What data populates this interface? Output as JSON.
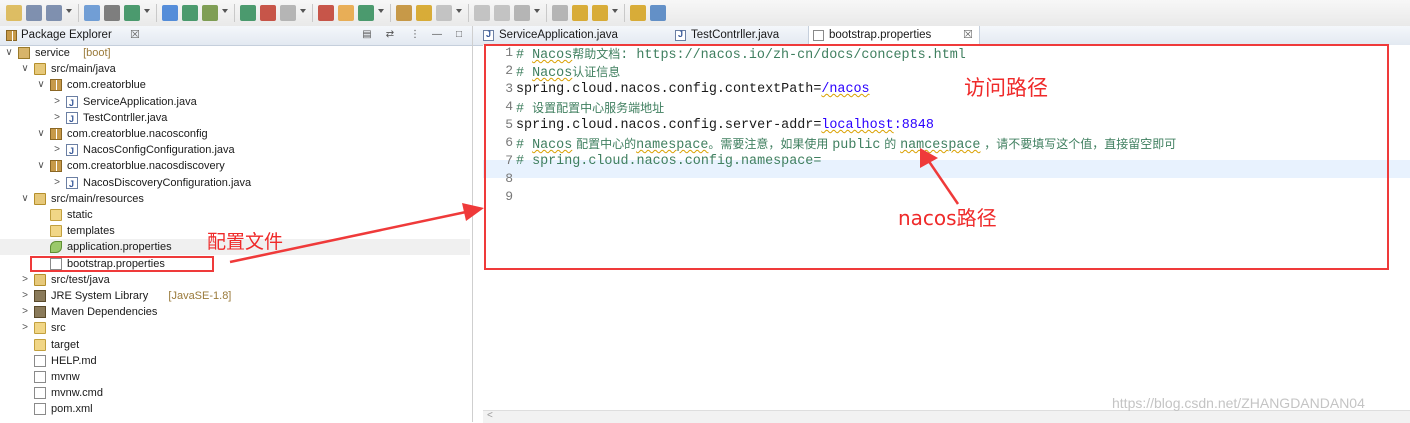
{
  "toolbar": {
    "icon_names": [
      "new-icon",
      "save-icon",
      "save-all-icon",
      "print-icon",
      "search-icon",
      "console-icon",
      "app-icon",
      "run-icon",
      "debug-icon",
      "run-dropdown-icon",
      "external-tools-icon",
      "stop-icon",
      "build-icon",
      "new-class-icon",
      "open-type-icon",
      "open-task-icon",
      "edit-icon",
      "mark-occurrences-icon",
      "block-icon",
      "show-whitespace-icon",
      "next-annotation-icon",
      "prev-annotation-icon",
      "back-icon",
      "forward-icon",
      "last-edit-icon",
      "open-perspective-icon"
    ]
  },
  "explorer": {
    "tab_label": "Package Explorer",
    "close_glyph": "☒",
    "rows": [
      {
        "depth": 0,
        "chev": "∨",
        "icon": "proj",
        "label": "service",
        "decoration": "[boot]"
      },
      {
        "depth": 1,
        "chev": "∨",
        "icon": "srcfolder",
        "label": "src/main/java",
        "decoration": ""
      },
      {
        "depth": 2,
        "chev": "∨",
        "icon": "pkg",
        "label": "com.creatorblue",
        "decoration": ""
      },
      {
        "depth": 3,
        "chev": ">",
        "icon": "java",
        "label": "ServiceApplication.java",
        "decoration": ""
      },
      {
        "depth": 3,
        "chev": ">",
        "icon": "java",
        "label": "TestContrller.java",
        "decoration": ""
      },
      {
        "depth": 2,
        "chev": "∨",
        "icon": "pkg",
        "label": "com.creatorblue.nacosconfig",
        "decoration": ""
      },
      {
        "depth": 3,
        "chev": ">",
        "icon": "java",
        "label": "NacosConfigConfiguration.java",
        "decoration": ""
      },
      {
        "depth": 2,
        "chev": "∨",
        "icon": "pkg",
        "label": "com.creatorblue.nacosdiscovery",
        "decoration": ""
      },
      {
        "depth": 3,
        "chev": ">",
        "icon": "java",
        "label": "NacosDiscoveryConfiguration.java",
        "decoration": ""
      },
      {
        "depth": 1,
        "chev": "∨",
        "icon": "srcfolder",
        "label": "src/main/resources",
        "decoration": ""
      },
      {
        "depth": 2,
        "chev": "",
        "icon": "folder",
        "label": "static",
        "decoration": ""
      },
      {
        "depth": 2,
        "chev": "",
        "icon": "folder",
        "label": "templates",
        "decoration": ""
      },
      {
        "depth": 2,
        "chev": "",
        "icon": "props",
        "label": "application.properties",
        "decoration": ""
      },
      {
        "depth": 2,
        "chev": "",
        "icon": "file",
        "label": "bootstrap.properties",
        "decoration": ""
      },
      {
        "depth": 1,
        "chev": ">",
        "icon": "srcfolder",
        "label": "src/test/java",
        "decoration": ""
      },
      {
        "depth": 1,
        "chev": ">",
        "icon": "lib",
        "label": "JRE System Library",
        "decoration": "[JavaSE-1.8]"
      },
      {
        "depth": 1,
        "chev": ">",
        "icon": "lib",
        "label": "Maven Dependencies",
        "decoration": ""
      },
      {
        "depth": 1,
        "chev": ">",
        "icon": "folder",
        "label": "src",
        "decoration": ""
      },
      {
        "depth": 1,
        "chev": "",
        "icon": "folder",
        "label": "target",
        "decoration": ""
      },
      {
        "depth": 1,
        "chev": "",
        "icon": "file",
        "label": "HELP.md",
        "decoration": ""
      },
      {
        "depth": 1,
        "chev": "",
        "icon": "file",
        "label": "mvnw",
        "decoration": ""
      },
      {
        "depth": 1,
        "chev": "",
        "icon": "file",
        "label": "mvnw.cmd",
        "decoration": ""
      },
      {
        "depth": 1,
        "chev": "",
        "icon": "file",
        "label": "pom.xml",
        "decoration": ""
      }
    ]
  },
  "editor": {
    "tabs": [
      {
        "label": "ServiceApplication.java",
        "active": false,
        "close": ""
      },
      {
        "label": "TestContrller.java",
        "active": false,
        "close": ""
      },
      {
        "label": "bootstrap.properties",
        "active": true,
        "close": "☒"
      }
    ],
    "lines": [
      {
        "num": "1",
        "segments": [
          {
            "t": "# ",
            "c": "c-comment"
          },
          {
            "t": "Nacos",
            "c": "c-comment squig"
          },
          {
            "t": "帮助文档",
            "c": "c-comment c-cjk"
          },
          {
            "t": ": https://nacos.io/zh-cn/docs/concepts.html",
            "c": "c-comment"
          }
        ]
      },
      {
        "num": "2",
        "segments": [
          {
            "t": "# ",
            "c": "c-comment"
          },
          {
            "t": "Nacos",
            "c": "c-comment squig"
          },
          {
            "t": "认证信息",
            "c": "c-comment c-cjk"
          }
        ]
      },
      {
        "num": "3",
        "segments": [
          {
            "t": "spring.cloud.nacos.config.contextPath=",
            "c": "c-key"
          },
          {
            "t": "/nacos",
            "c": "c-val squig"
          }
        ]
      },
      {
        "num": "4",
        "segments": [
          {
            "t": "# ",
            "c": "c-comment"
          },
          {
            "t": "设置配置中心服务端地址",
            "c": "c-comment c-cjk"
          }
        ]
      },
      {
        "num": "5",
        "segments": [
          {
            "t": "spring.cloud.nacos.config.server-addr=",
            "c": "c-key"
          },
          {
            "t": "localhost",
            "c": "c-val squig"
          },
          {
            "t": ":8848",
            "c": "c-val"
          }
        ]
      },
      {
        "num": "6",
        "segments": [
          {
            "t": "# ",
            "c": "c-comment"
          },
          {
            "t": "Nacos",
            "c": "c-comment squig"
          },
          {
            "t": " 配置中心的",
            "c": "c-comment c-cjk"
          },
          {
            "t": "namespace",
            "c": "c-comment squig"
          },
          {
            "t": "。需要注意，如果使用 ",
            "c": "c-comment c-cjk"
          },
          {
            "t": "public",
            "c": "c-comment"
          },
          {
            "t": " 的 ",
            "c": "c-comment c-cjk"
          },
          {
            "t": "namcespace",
            "c": "c-comment squig"
          },
          {
            "t": " ，请不要填写这个值，直接留空即可",
            "c": "c-comment c-cjk"
          }
        ]
      },
      {
        "num": "7",
        "segments": [
          {
            "t": "# spring.cloud.nacos.config.namespace=",
            "c": "c-comment"
          }
        ]
      },
      {
        "num": "8",
        "segments": []
      },
      {
        "num": "9",
        "segments": []
      }
    ],
    "scroll_arrow": "<"
  },
  "annotations": {
    "config_file": "配置文件",
    "access_path": "访问路径",
    "nacos_path": "nacos路径",
    "color": "#ef2a2a"
  },
  "watermark": "https://blog.csdn.net/ZHANGDANDAN04"
}
